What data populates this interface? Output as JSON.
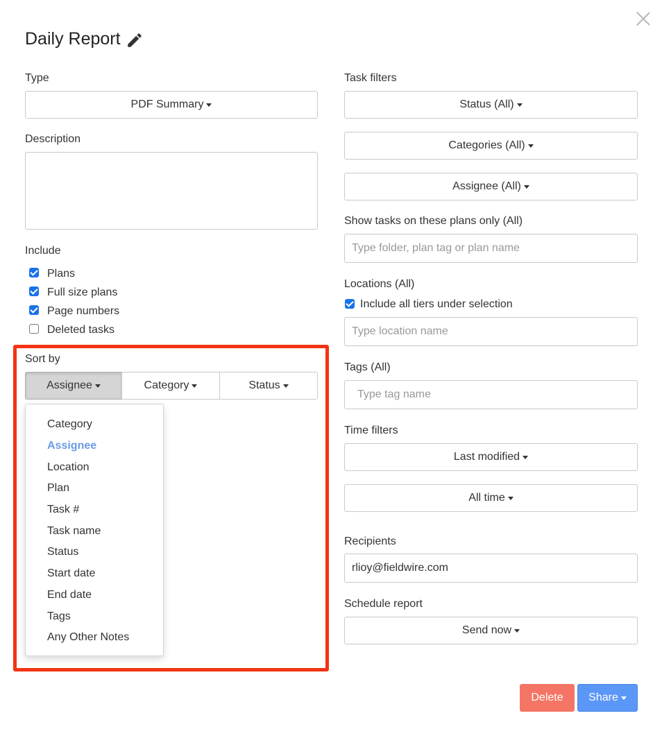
{
  "dialog": {
    "title": "Daily Report",
    "edit_icon": "pencil-icon",
    "close_icon": "close-icon"
  },
  "left": {
    "type_label": "Type",
    "type_value": "PDF Summary",
    "description_label": "Description",
    "description_value": "",
    "include_label": "Include",
    "include_items": [
      {
        "label": "Plans",
        "checked": true
      },
      {
        "label": "Full size plans",
        "checked": true
      },
      {
        "label": "Page numbers",
        "checked": true
      },
      {
        "label": "Deleted tasks",
        "checked": false
      }
    ],
    "sort_label": "Sort by",
    "sort_buttons": [
      "Assignee",
      "Category",
      "Status"
    ],
    "sort_active": "Assignee",
    "sort_options": [
      "Category",
      "Assignee",
      "Location",
      "Plan",
      "Task #",
      "Task name",
      "Status",
      "Start date",
      "End date",
      "Tags",
      "Any Other Notes"
    ],
    "sort_options_selected": "Assignee"
  },
  "right": {
    "task_filters_label": "Task filters",
    "status_filter": "Status (All)",
    "categories_filter": "Categories (All)",
    "assignee_filter": "Assignee (All)",
    "plans_label": "Show tasks on these plans only (All)",
    "plans_placeholder": "Type folder, plan tag or plan name",
    "locations_label": "Locations (All)",
    "include_tiers_label": "Include all tiers under selection",
    "include_tiers_checked": true,
    "location_placeholder": "Type location name",
    "tags_label": "Tags (All)",
    "tags_placeholder": "Type tag name",
    "time_filters_label": "Time filters",
    "time_field": "Last modified",
    "time_range": "All time",
    "recipients_label": "Recipients",
    "recipients_value": "rlioy@fieldwire.com",
    "schedule_label": "Schedule report",
    "schedule_value": "Send now"
  },
  "footer": {
    "delete_label": "Delete",
    "share_label": "Share"
  },
  "colors": {
    "primary": "#5b97f6",
    "danger": "#f47565",
    "highlight": "#f23413",
    "selected_option": "#6b9ce4",
    "checkbox": "#1a73e8"
  }
}
